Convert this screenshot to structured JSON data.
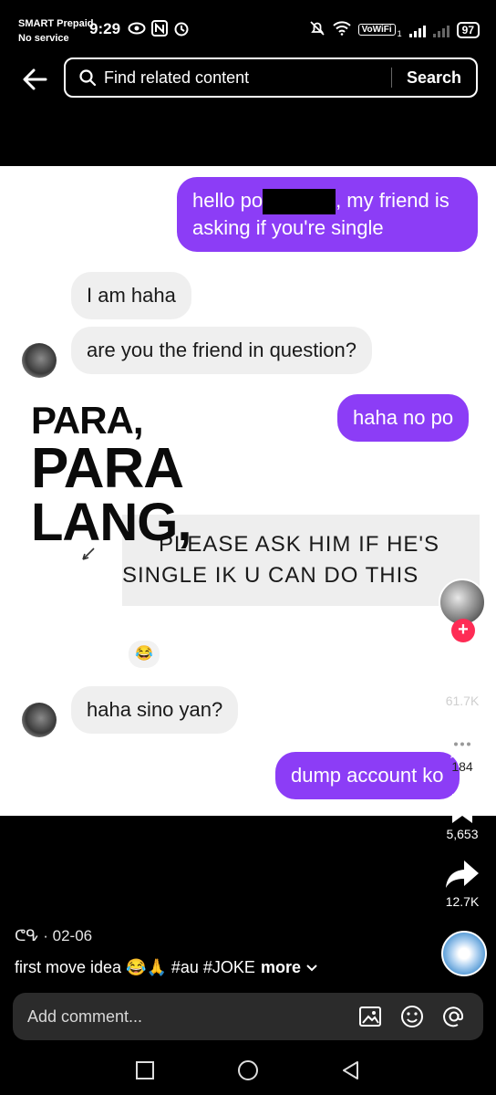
{
  "status_bar": {
    "carrier": "SMART Prepaid",
    "service": "No service",
    "time": "9:29",
    "vowifi": "VoWiFi",
    "vowifi_sub": "1",
    "battery": "97"
  },
  "top_bar": {
    "search_placeholder": "Find related content",
    "search_button": "Search"
  },
  "chat": {
    "msg1_before": "hello po",
    "msg1_after": ", my friend is asking if you're single",
    "msg2": "I am haha",
    "msg3": "are you the friend in question?",
    "msg4": "haha no po",
    "reply_line1": "PLEASE ASK HIM IF HE'S",
    "reply_line2": "SINGLE IK U CAN DO THIS",
    "reaction": "😂",
    "msg5": "haha sino yan?",
    "msg6": "dump account ko"
  },
  "overlay_text": {
    "line1": "PARA,",
    "line2": "PARA",
    "line3": "LANG,"
  },
  "rail": {
    "likes": "61.7K",
    "comments": "184",
    "saves": "5,653",
    "shares": "12.7K"
  },
  "caption": {
    "username": "ᕦᕴ",
    "date": "· 02-06",
    "text": "first move idea 😂🙏 #au #JOKE",
    "more": "more"
  },
  "comment_bar": {
    "placeholder": "Add comment..."
  },
  "colors": {
    "outgoing_bubble": "#8c3df6",
    "incoming_bubble": "#efefef",
    "follow_badge": "#fe2c55"
  }
}
